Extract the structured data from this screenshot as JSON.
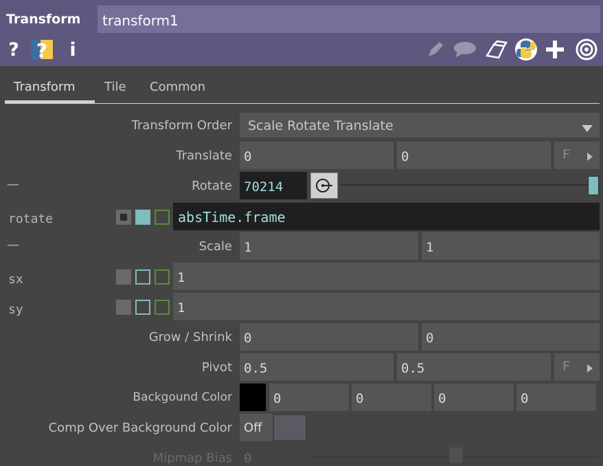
{
  "header": {
    "op_type": "Transform",
    "op_name": "transform1",
    "left_icons": [
      "help-icon",
      "python-help-icon",
      "info-icon"
    ],
    "right_icons": [
      "edit-icon",
      "comment-icon",
      "clone-icon",
      "python-icon",
      "add-icon",
      "viewer-target-icon"
    ]
  },
  "tabs": [
    "Transform",
    "Tile",
    "Common"
  ],
  "active_tab": "Transform",
  "params": {
    "transform_order": {
      "label": "Transform Order",
      "value": "Scale Rotate Translate"
    },
    "translate": {
      "label": "Translate",
      "x": "0",
      "y": "0",
      "unit_button": "F"
    },
    "rotate": {
      "label": "Rotate",
      "value": "70214",
      "side_label": "—"
    },
    "rotate_expr": {
      "label": "rotate",
      "expression": "absTime.frame"
    },
    "scale": {
      "label": "Scale",
      "x": "1",
      "y": "1",
      "side_label": "—"
    },
    "sx": {
      "label": "sx",
      "value": "1"
    },
    "sy": {
      "label": "sy",
      "value": "1"
    },
    "grow_shrink": {
      "label": "Grow / Shrink",
      "x": "0",
      "y": "0"
    },
    "pivot": {
      "label": "Pivot",
      "x": "0.5",
      "y": "0.5",
      "unit_button": "F"
    },
    "bg_color": {
      "label": "Backgound Color",
      "r": "0",
      "g": "0",
      "b": "0",
      "a": "0",
      "swatch": "#000000"
    },
    "comp_over": {
      "label": "Comp Over Background Color",
      "value": "Off"
    },
    "mipmap_bias": {
      "label": "Mipmap Bias",
      "value": "0"
    }
  },
  "colors": {
    "header_bg": "#5f587e",
    "name_field_bg": "#776e99",
    "panel_bg": "#444444",
    "field_bg": "#555555",
    "accent_cyan": "#7fc4c4",
    "accent_green": "#5f8a3c"
  }
}
